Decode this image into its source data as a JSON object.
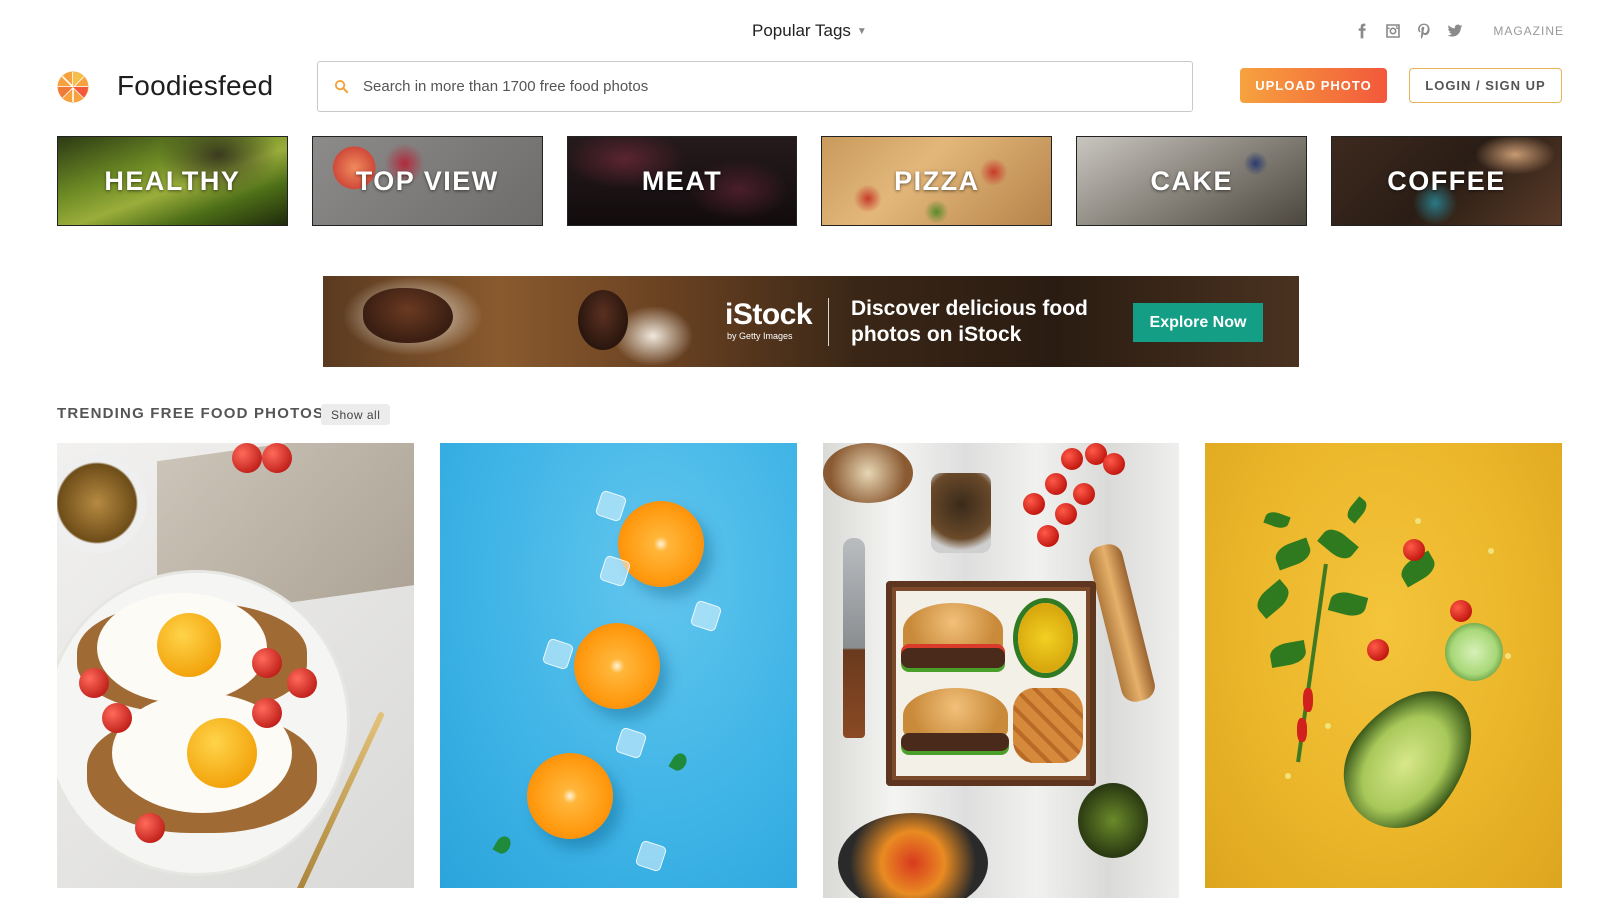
{
  "header": {
    "popular_tags": "Popular Tags",
    "magazine": "MAGAZINE",
    "social_icons": [
      "facebook-icon",
      "instagram-icon",
      "pinterest-icon",
      "twitter-icon"
    ]
  },
  "brand": {
    "name": "Foodiesfeed",
    "colors": {
      "orange": "#f7a23e",
      "red": "#f2583b"
    }
  },
  "search": {
    "placeholder": "Search in more than 1700 free food photos",
    "value": ""
  },
  "actions": {
    "upload": "UPLOAD PHOTO",
    "login": "LOGIN / SIGN UP"
  },
  "categories": [
    {
      "label": "HEALTHY"
    },
    {
      "label": "TOP VIEW"
    },
    {
      "label": "MEAT"
    },
    {
      "label": "PIZZA"
    },
    {
      "label": "CAKE"
    },
    {
      "label": "COFFEE"
    }
  ],
  "ad": {
    "brand": "iStock",
    "byline": "by Getty Images",
    "headline": "Discover delicious food photos on iStock",
    "cta": "Explore Now",
    "cta_color": "#149e86"
  },
  "trending": {
    "title": "TRENDING FREE FOOD PHOTOS",
    "show_all": "Show all"
  }
}
